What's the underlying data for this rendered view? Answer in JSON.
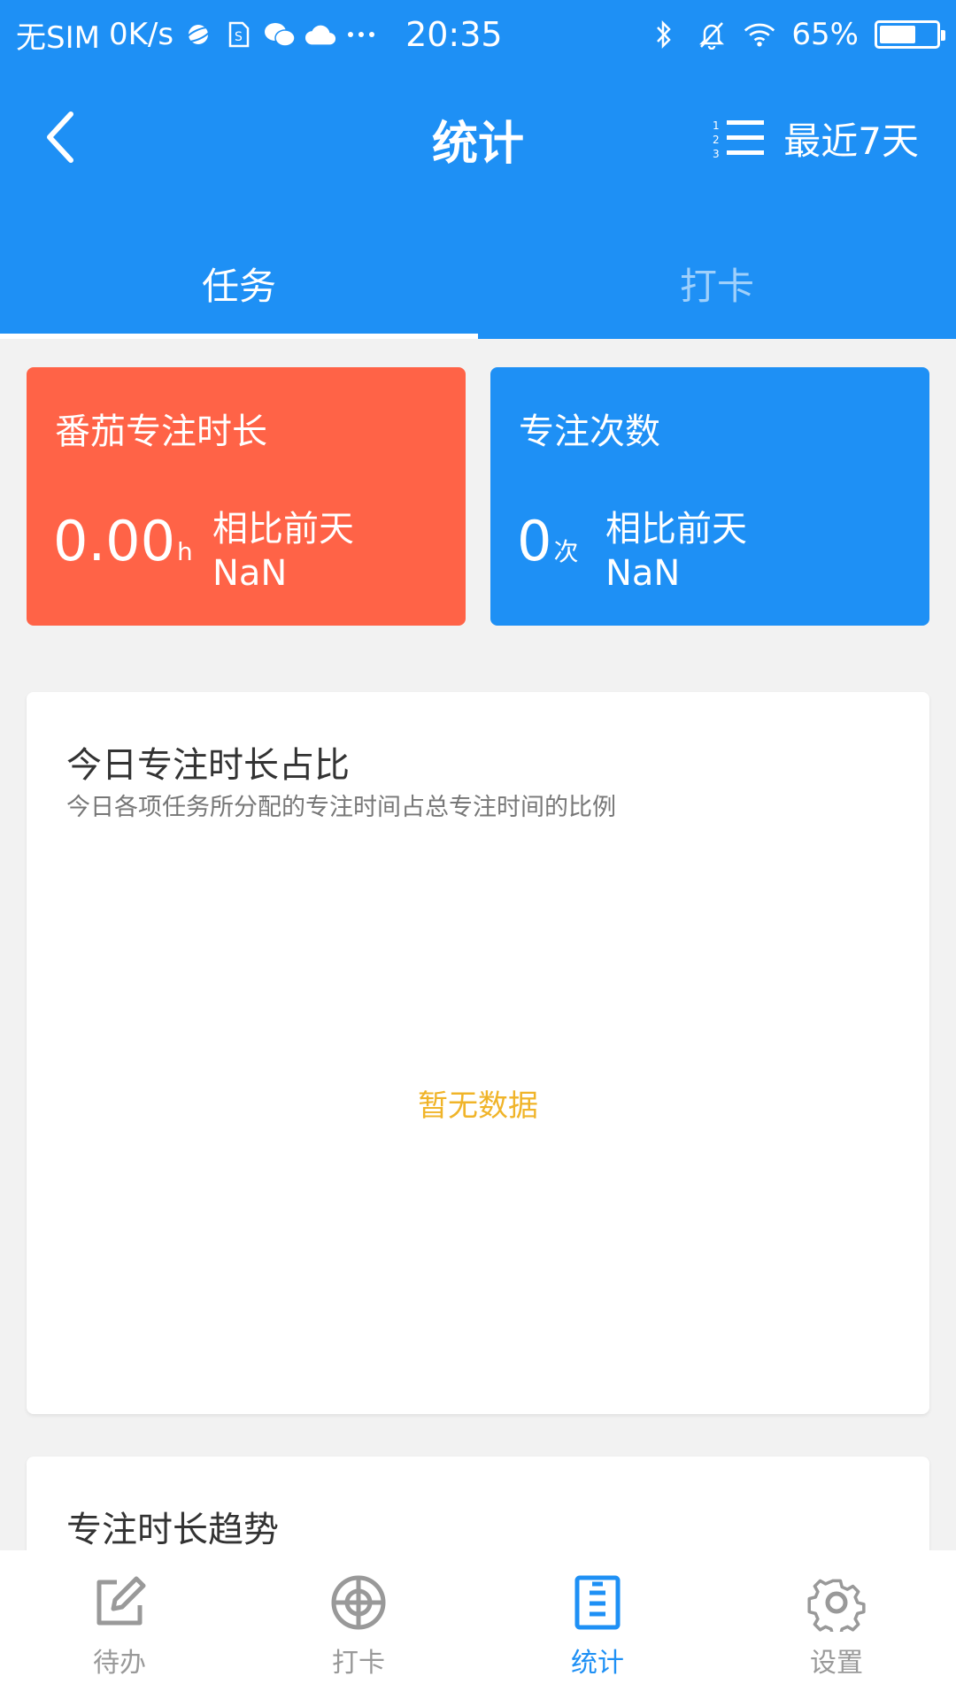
{
  "status_bar": {
    "sim": "无SIM",
    "speed": "0K/s",
    "time": "20:35",
    "battery": "65%",
    "battery_level": 0.65
  },
  "nav": {
    "title": "统计",
    "range_label": "最近7天"
  },
  "tabs": [
    {
      "label": "任务",
      "active": true
    },
    {
      "label": "打卡",
      "active": false
    }
  ],
  "stats": {
    "tomato": {
      "title": "番茄专注时长",
      "value": "0.00",
      "unit": "h",
      "compare_label": "相比前天",
      "compare_value": "NaN"
    },
    "count": {
      "title": "专注次数",
      "value": "0",
      "unit": "次",
      "compare_label": "相比前天",
      "compare_value": "NaN"
    }
  },
  "ratio_panel": {
    "title": "今日专注时长占比",
    "subtitle": "今日各项任务所分配的专注时间占总专注时间的比例",
    "empty": "暂无数据"
  },
  "trend_panel": {
    "title": "专注时长趋势"
  },
  "bottom_nav": [
    {
      "label": "待办",
      "icon": "edit-icon",
      "active": false
    },
    {
      "label": "打卡",
      "icon": "target-icon",
      "active": false
    },
    {
      "label": "统计",
      "icon": "stats-icon",
      "active": true
    },
    {
      "label": "设置",
      "icon": "gear-icon",
      "active": false
    }
  ],
  "colors": {
    "primary": "#1e90f5",
    "orange": "#ff6347",
    "empty_text": "#f0b429"
  }
}
